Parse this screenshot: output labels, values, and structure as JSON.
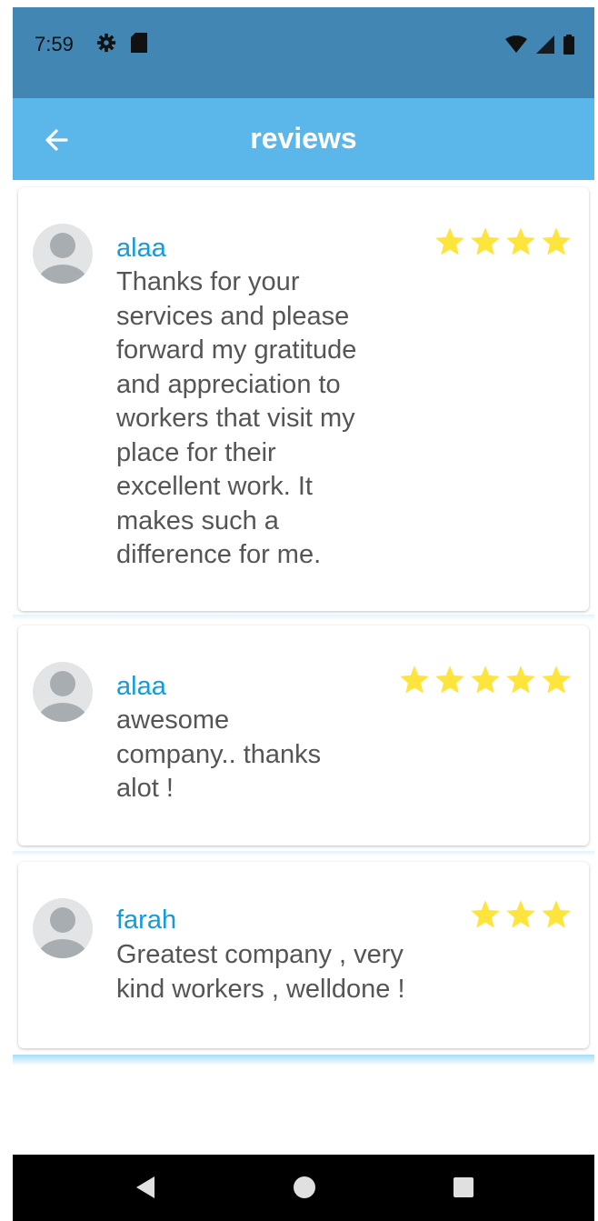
{
  "status_bar": {
    "time": "7:59",
    "icons": [
      "gear-icon",
      "sd-card-icon",
      "wifi-icon",
      "signal-icon",
      "battery-icon"
    ]
  },
  "app_bar": {
    "title": "reviews",
    "back_icon": "arrow-left-icon"
  },
  "colors": {
    "status_bar": "#4286b4",
    "app_bar": "#5bb7ea",
    "name": "#149bd8",
    "text": "#555555",
    "star": "#ffe43b"
  },
  "reviews": [
    {
      "name": "alaa",
      "text_lines": [
        "Thanks for your",
        "services and please",
        "forward my gratitude",
        "and appreciation to",
        "workers that visit my",
        "place for their",
        "excellent work. It",
        "makes such a",
        "difference for me."
      ],
      "rating": 4
    },
    {
      "name": "alaa",
      "text_lines": [
        "awesome",
        "company.. thanks",
        "alot !"
      ],
      "rating": 5
    },
    {
      "name": "farah",
      "text_lines": [
        "Greatest company , very",
        "kind workers , welldone !"
      ],
      "rating": 3
    }
  ],
  "nav_bar": {
    "buttons": [
      "back-triangle-icon",
      "home-circle-icon",
      "recents-square-icon"
    ]
  }
}
